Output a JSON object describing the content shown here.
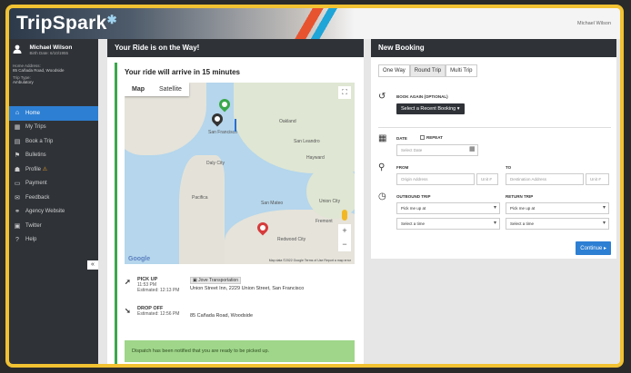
{
  "app": {
    "logo": "TripSpark",
    "logo_mark": "✱",
    "user_top": "Michael Wilson"
  },
  "sidebar": {
    "name": "Michael Wilson",
    "id": "Birth Date: 6/10/1955",
    "address_label": "Home Address:",
    "address": "85 Cañada Road, Woodside",
    "trip_type_label": "Trip Type:",
    "trip_type": "Ambulatory",
    "items": [
      {
        "label": "Home",
        "icon": "home-icon",
        "glyph": "⌂"
      },
      {
        "label": "My Trips",
        "icon": "calendar-icon",
        "glyph": "▦"
      },
      {
        "label": "Book a Trip",
        "icon": "document-icon",
        "glyph": "▤"
      },
      {
        "label": "Bulletins",
        "icon": "flag-icon",
        "glyph": "⚑"
      },
      {
        "label": "Profile",
        "icon": "user-icon",
        "glyph": "☗"
      },
      {
        "label": "Payment",
        "icon": "card-icon",
        "glyph": "▭"
      },
      {
        "label": "Feedback",
        "icon": "chat-icon",
        "glyph": "✉"
      },
      {
        "label": "Agency Website",
        "icon": "link-icon",
        "glyph": "⚭"
      },
      {
        "label": "Twitter",
        "icon": "twitter-icon",
        "glyph": "▣"
      },
      {
        "label": "Help",
        "icon": "help-icon",
        "glyph": "?"
      }
    ],
    "profile_warning": "⚠",
    "collapse_glyph": "«"
  },
  "ride": {
    "title": "Your Ride is on the Way!",
    "arrive": "Your ride will arrive in 15 minutes",
    "map_tab_map": "Map",
    "map_tab_satellite": "Satellite",
    "google": "Google",
    "map_copyright": "Map data ©2022 Google   Terms of Use   Report a map error",
    "labels": [
      "San Francisco",
      "Daly City",
      "Oakland",
      "San Mateo",
      "Redwood City",
      "Hayward",
      "Fremont",
      "Pacifica",
      "San Leandro",
      "Union City"
    ],
    "pickup_label": "PICK UP",
    "pickup_time": "11:53 PM",
    "pickup_est": "Estimated: 12:13 PM",
    "pickup_agency": "Jove Transportation",
    "pickup_address": "Union Street Inn, 2229 Union Street, San Francisco",
    "dropoff_label": "DROP OFF",
    "dropoff_est": "Estimated: 12:56 PM",
    "dropoff_address": "85 Cañada Road, Woodside",
    "notify": "Dispatch has been notified that you are ready to be picked up."
  },
  "booking": {
    "title": "New Booking",
    "tabs": [
      "One Way",
      "Round Trip",
      "Multi Trip"
    ],
    "selected_tab": "Round Trip",
    "book_again_label": "BOOK AGAIN (OPTIONAL)",
    "recent_button": "Select a Recent Booking ▾",
    "date_label": "DATE",
    "repeat_label": "REPEAT",
    "date_placeholder": "Select Date",
    "from_label": "FROM",
    "to_label": "TO",
    "origin_placeholder": "Origin Address",
    "dest_placeholder": "Destination Address",
    "unit_placeholder": "Unit #",
    "outbound_label": "OUTBOUND TRIP",
    "return_label": "RETURN TRIP",
    "pick_me_up": "Pick me up at",
    "select_time": "Select a time",
    "continue": "Continue ▸"
  },
  "colors": {
    "accent": "#2d7fd3",
    "frame": "#f2c232",
    "sidebar": "#2f3338",
    "success": "#3aa84a"
  }
}
